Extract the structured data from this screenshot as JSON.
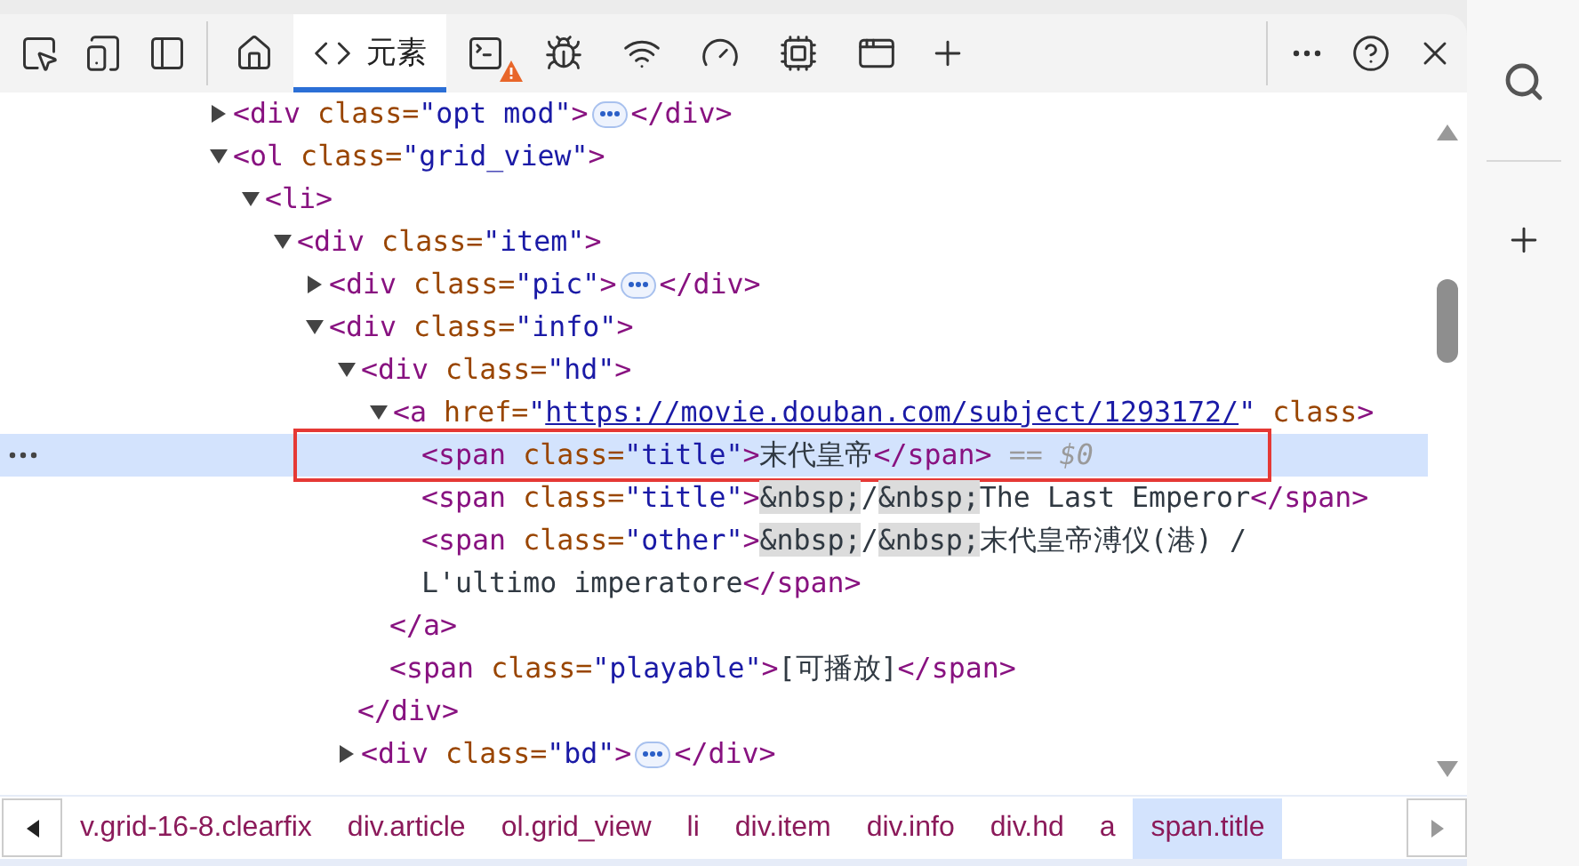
{
  "tabs": [
    {
      "kind": "home",
      "selected": false
    },
    {
      "kind": "elements",
      "label": "元素",
      "selected": true
    },
    {
      "kind": "console",
      "selected": false,
      "warning": true
    },
    {
      "kind": "sources",
      "selected": false
    },
    {
      "kind": "network",
      "selected": false
    },
    {
      "kind": "performance",
      "selected": false
    },
    {
      "kind": "memory",
      "selected": false
    },
    {
      "kind": "application",
      "selected": false
    }
  ],
  "dom_tree": [
    {
      "selected": false,
      "expanded": false,
      "tokens": [
        {
          "kind": "tag",
          "text": "<div"
        },
        {
          "kind": "attr",
          "text": " class="
        },
        {
          "kind": "value",
          "text": "\"opt mod\""
        },
        {
          "kind": "tag",
          "text": ">"
        },
        {
          "kind": "ellipsis"
        },
        {
          "kind": "tag",
          "text": "</div>"
        }
      ]
    },
    {
      "selected": false,
      "expanded": true,
      "tokens": [
        {
          "kind": "tag",
          "text": "<ol"
        },
        {
          "kind": "attr",
          "text": " class="
        },
        {
          "kind": "value",
          "text": "\"grid_view\""
        },
        {
          "kind": "tag",
          "text": ">"
        }
      ],
      "children": [
        {
          "selected": false,
          "expanded": true,
          "tokens": [
            {
              "kind": "tag",
              "text": "<li>"
            }
          ],
          "children": [
            {
              "selected": false,
              "expanded": true,
              "tokens": [
                {
                  "kind": "tag",
                  "text": "<div"
                },
                {
                  "kind": "attr",
                  "text": " class="
                },
                {
                  "kind": "value",
                  "text": "\"item\""
                },
                {
                  "kind": "tag",
                  "text": ">"
                }
              ],
              "children": [
                {
                  "selected": false,
                  "expanded": false,
                  "tokens": [
                    {
                      "kind": "tag",
                      "text": "<div"
                    },
                    {
                      "kind": "attr",
                      "text": " class="
                    },
                    {
                      "kind": "value",
                      "text": "\"pic\""
                    },
                    {
                      "kind": "tag",
                      "text": ">"
                    },
                    {
                      "kind": "ellipsis"
                    },
                    {
                      "kind": "tag",
                      "text": "</div>"
                    }
                  ]
                },
                {
                  "selected": false,
                  "expanded": true,
                  "tokens": [
                    {
                      "kind": "tag",
                      "text": "<div"
                    },
                    {
                      "kind": "attr",
                      "text": " class="
                    },
                    {
                      "kind": "value",
                      "text": "\"info\""
                    },
                    {
                      "kind": "tag",
                      "text": ">"
                    }
                  ],
                  "children": [
                    {
                      "selected": false,
                      "expanded": true,
                      "tokens": [
                        {
                          "kind": "tag",
                          "text": "<div"
                        },
                        {
                          "kind": "attr",
                          "text": " class="
                        },
                        {
                          "kind": "value",
                          "text": "\"hd\""
                        },
                        {
                          "kind": "tag",
                          "text": ">"
                        }
                      ],
                      "close": [
                        {
                          "kind": "tag",
                          "text": "</div>"
                        }
                      ],
                      "children": [
                        {
                          "selected": false,
                          "expanded": true,
                          "tokens": [
                            {
                              "kind": "tag",
                              "text": "<a"
                            },
                            {
                              "kind": "attr",
                              "text": " href="
                            },
                            {
                              "kind": "value",
                              "text": "\""
                            },
                            {
                              "kind": "link",
                              "text": "https://movie.douban.com/subject/1293172/"
                            },
                            {
                              "kind": "value",
                              "text": "\""
                            },
                            {
                              "kind": "attr",
                              "text": " class"
                            },
                            {
                              "kind": "tag",
                              "text": ">"
                            }
                          ],
                          "close": [
                            {
                              "kind": "tag",
                              "text": "</a>"
                            }
                          ],
                          "children": [
                            {
                              "selected": true,
                              "tokens": [
                                {
                                  "kind": "tag",
                                  "text": "<span"
                                },
                                {
                                  "kind": "attr",
                                  "text": " class="
                                },
                                {
                                  "kind": "value",
                                  "text": "\"title\""
                                },
                                {
                                  "kind": "tag",
                                  "text": ">"
                                },
                                {
                                  "kind": "text",
                                  "text": "末代皇帝"
                                },
                                {
                                  "kind": "tag",
                                  "text": "</span>"
                                },
                                {
                                  "kind": "hint",
                                  "text": " == $0"
                                }
                              ]
                            },
                            {
                              "selected": false,
                              "tokens": [
                                {
                                  "kind": "tag",
                                  "text": "<span"
                                },
                                {
                                  "kind": "attr",
                                  "text": " class="
                                },
                                {
                                  "kind": "value",
                                  "text": "\"title\""
                                },
                                {
                                  "kind": "tag",
                                  "text": ">"
                                },
                                {
                                  "kind": "entity",
                                  "text": "&nbsp;"
                                },
                                {
                                  "kind": "text",
                                  "text": "/"
                                },
                                {
                                  "kind": "entity",
                                  "text": "&nbsp;"
                                },
                                {
                                  "kind": "text",
                                  "text": "The Last Emperor"
                                },
                                {
                                  "kind": "tag",
                                  "text": "</span>"
                                }
                              ]
                            },
                            {
                              "selected": false,
                              "tokens": [
                                {
                                  "kind": "tag",
                                  "text": "<span"
                                },
                                {
                                  "kind": "attr",
                                  "text": " class="
                                },
                                {
                                  "kind": "value",
                                  "text": "\"other\""
                                },
                                {
                                  "kind": "tag",
                                  "text": ">"
                                },
                                {
                                  "kind": "entity",
                                  "text": "&nbsp;"
                                },
                                {
                                  "kind": "text",
                                  "text": "/"
                                },
                                {
                                  "kind": "entity",
                                  "text": "&nbsp;"
                                },
                                {
                                  "kind": "text",
                                  "text": "末代皇帝溥仪(港) /"
                                },
                                {
                                  "kind": "break"
                                },
                                {
                                  "kind": "text",
                                  "text": "L'ultimo imperatore"
                                },
                                {
                                  "kind": "tag",
                                  "text": "</span>"
                                }
                              ]
                            }
                          ]
                        },
                        {
                          "selected": false,
                          "tokens": [
                            {
                              "kind": "tag",
                              "text": "<span"
                            },
                            {
                              "kind": "attr",
                              "text": " class="
                            },
                            {
                              "kind": "value",
                              "text": "\"playable\""
                            },
                            {
                              "kind": "tag",
                              "text": ">"
                            },
                            {
                              "kind": "text",
                              "text": "[可播放]"
                            },
                            {
                              "kind": "tag",
                              "text": "</span>"
                            }
                          ]
                        }
                      ]
                    },
                    {
                      "selected": false,
                      "expanded": false,
                      "tokens": [
                        {
                          "kind": "tag",
                          "text": "<div"
                        },
                        {
                          "kind": "attr",
                          "text": " class="
                        },
                        {
                          "kind": "value",
                          "text": "\"bd\""
                        },
                        {
                          "kind": "tag",
                          "text": ">"
                        },
                        {
                          "kind": "ellipsis"
                        },
                        {
                          "kind": "tag",
                          "text": "</div>"
                        }
                      ]
                    }
                  ]
                }
              ]
            }
          ]
        }
      ]
    }
  ],
  "breadcrumbs": [
    {
      "label": "v.grid-16-8.clearfix",
      "selected": false
    },
    {
      "label": "div.article",
      "selected": false
    },
    {
      "label": "ol.grid_view",
      "selected": false
    },
    {
      "label": "li",
      "selected": false
    },
    {
      "label": "div.item",
      "selected": false
    },
    {
      "label": "div.info",
      "selected": false
    },
    {
      "label": "div.hd",
      "selected": false
    },
    {
      "label": "a",
      "selected": false
    },
    {
      "label": "span.title",
      "selected": true
    }
  ]
}
